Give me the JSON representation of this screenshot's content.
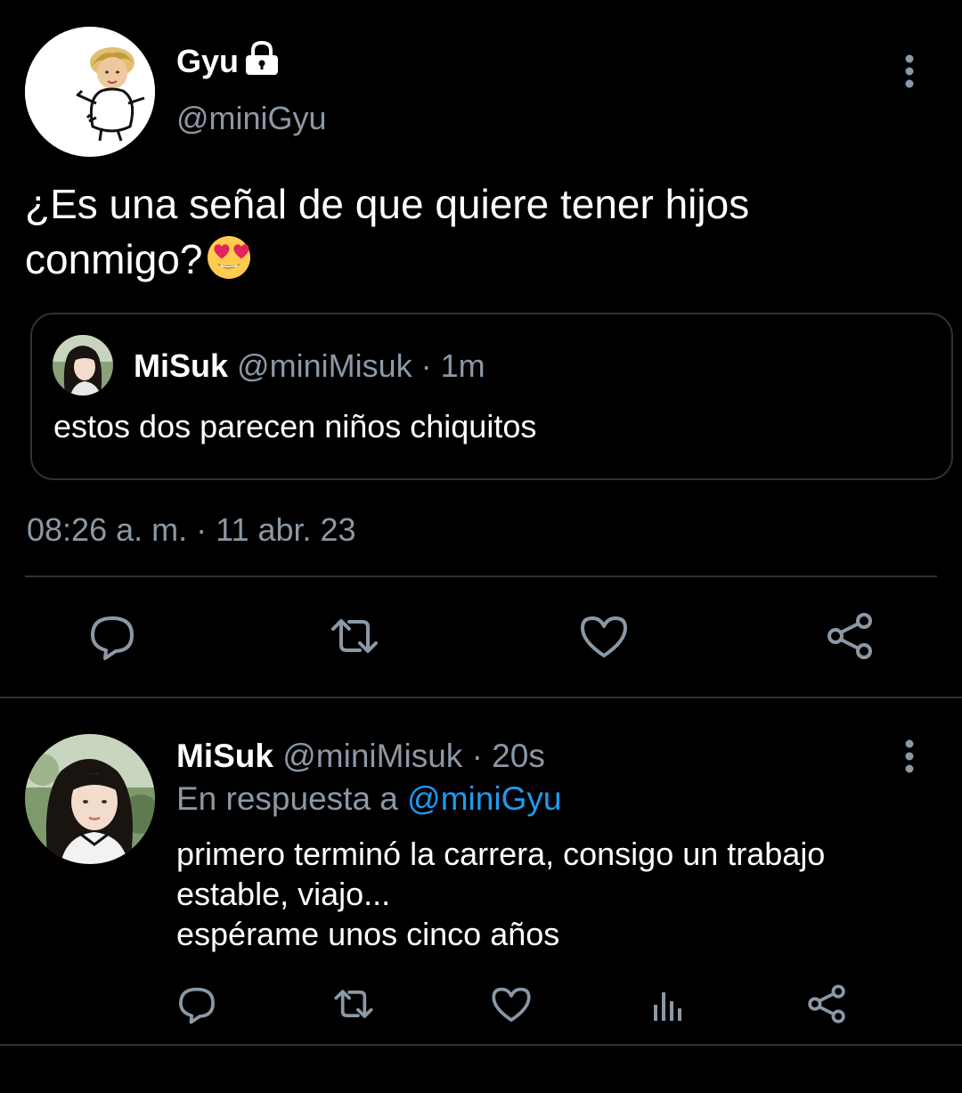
{
  "tweet": {
    "author_name": "Gyu",
    "author_handle": "@miniGyu",
    "text": "¿Es una señal de que quiere tener hijos conmigo?",
    "emoji": "heart-eyes-emoji",
    "quote": {
      "author_name": "MiSuk",
      "author_handle": "@miniMisuk",
      "time": "· 1m",
      "text": "estos dos parecen niños chiquitos"
    },
    "timestamp": "08:26 a. m. · 11 abr. 23",
    "actions": [
      "reply-icon",
      "retweet-icon",
      "like-icon",
      "share-icon"
    ]
  },
  "reply": {
    "author_name": "MiSuk",
    "author_handle": "@miniMisuk",
    "time": "· 20s",
    "replying_prefix": "En respuesta a",
    "replying_mention": "@miniGyu",
    "lines": [
      "primero terminó la carrera, consigo un trabajo",
      "estable, viajo...",
      "espérame unos cinco años"
    ],
    "actions": [
      "reply-icon",
      "retweet-icon",
      "like-icon",
      "views-icon",
      "share-icon"
    ]
  },
  "colors": {
    "background": "#000000",
    "primary_text": "#ffffff",
    "secondary_text": "#8b98a5",
    "link": "#1d9bf0",
    "border": "#2f3336",
    "icon": "#8b98a5"
  }
}
